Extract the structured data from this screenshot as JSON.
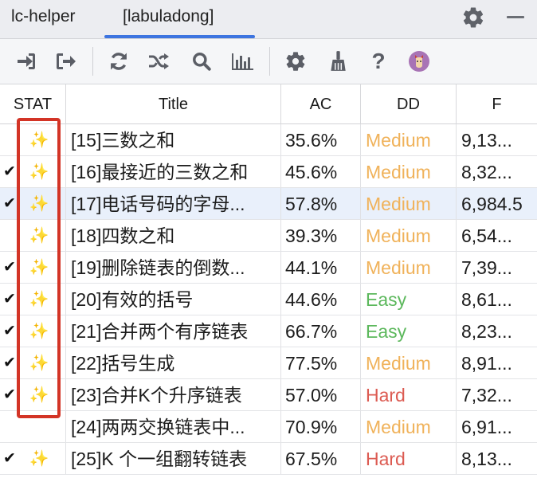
{
  "tabs": [
    {
      "label": "lc-helper"
    },
    {
      "label": "[labuladong]"
    }
  ],
  "toolbar": {
    "icons": [
      "login-icon",
      "logout-icon",
      "refresh-icon",
      "shuffle-icon",
      "search-icon",
      "chart-icon",
      "settings-icon",
      "clean-icon",
      "help-icon",
      "avatar-icon"
    ],
    "help_label": "?"
  },
  "table": {
    "columns": [
      "STAT",
      "Title",
      "AC",
      "DD",
      "F"
    ],
    "rows": [
      {
        "check": "",
        "spark": "✨",
        "title": "[15]三数之和",
        "ac": "35.6%",
        "dd": "Medium",
        "f": "9,13..."
      },
      {
        "check": "✔",
        "spark": "✨",
        "title": "[16]最接近的三数之和",
        "ac": "45.6%",
        "dd": "Medium",
        "f": "8,32..."
      },
      {
        "check": "✔",
        "spark": "✨",
        "title": "[17]电话号码的字母...",
        "ac": "57.8%",
        "dd": "Medium",
        "f": "6,984.5"
      },
      {
        "check": "",
        "spark": "✨",
        "title": "[18]四数之和",
        "ac": "39.3%",
        "dd": "Medium",
        "f": "6,54..."
      },
      {
        "check": "✔",
        "spark": "✨",
        "title": "[19]删除链表的倒数...",
        "ac": "44.1%",
        "dd": "Medium",
        "f": "7,39..."
      },
      {
        "check": "✔",
        "spark": "✨",
        "title": "[20]有效的括号",
        "ac": "44.6%",
        "dd": "Easy",
        "f": "8,61..."
      },
      {
        "check": "✔",
        "spark": "✨",
        "title": "[21]合并两个有序链表",
        "ac": "66.7%",
        "dd": "Easy",
        "f": "8,23..."
      },
      {
        "check": "✔",
        "spark": "✨",
        "title": "[22]括号生成",
        "ac": "77.5%",
        "dd": "Medium",
        "f": "8,91..."
      },
      {
        "check": "✔",
        "spark": "✨",
        "title": "[23]合并K个升序链表",
        "ac": "57.0%",
        "dd": "Hard",
        "f": "7,32..."
      },
      {
        "check": "",
        "spark": "",
        "title": "[24]两两交换链表中...",
        "ac": "70.9%",
        "dd": "Medium",
        "f": "6,91..."
      },
      {
        "check": "✔",
        "spark": "✨",
        "title": "[25]K 个一组翻转链表",
        "ac": "67.5%",
        "dd": "Hard",
        "f": "8,13..."
      }
    ],
    "selected_row": 2
  },
  "colors": {
    "Easy": "#5cb85c",
    "Medium": "#f0b25a",
    "Hard": "#dc5b52",
    "highlight": "#d33426",
    "tab_underline": "#3d74e0"
  }
}
